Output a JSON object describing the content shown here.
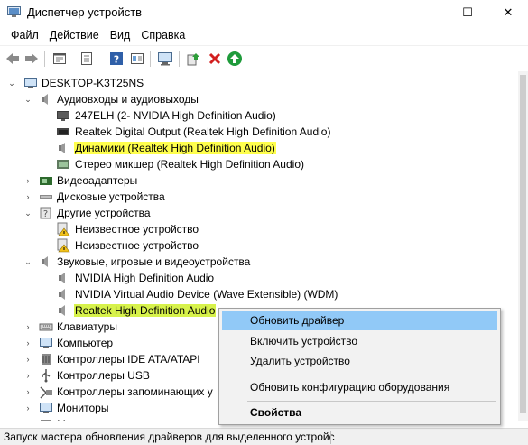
{
  "window": {
    "title": "Диспетчер устройств",
    "minimize_glyph": "—",
    "maximize_glyph": "☐",
    "close_glyph": "✕"
  },
  "menubar": [
    "Файл",
    "Действие",
    "Вид",
    "Справка"
  ],
  "toolbar": {
    "buttons": [
      "back-arrow-icon",
      "forward-arrow-icon",
      "properties-icon",
      "update-list-icon",
      "help-icon",
      "details-icon",
      "monitor-icon",
      "update-driver-icon",
      "remove-device-icon",
      "enable-device-icon"
    ]
  },
  "tree": {
    "root": "DESKTOP-K3T25NS",
    "audio_io": {
      "label": "Аудиовходы и аудиовыходы",
      "children": [
        "247ELH (2- NVIDIA High Definition Audio)",
        "Realtek Digital Output (Realtek High Definition Audio)",
        "Динамики (Realtek High Definition Audio)",
        "Стерео микшер (Realtek High Definition Audio)"
      ]
    },
    "video_adapters": "Видеоадаптеры",
    "disk_devices": "Дисковые устройства",
    "other_devices": {
      "label": "Другие устройства",
      "children": [
        "Неизвестное устройство",
        "Неизвестное устройство"
      ]
    },
    "sound_devices": {
      "label": "Звуковые, игровые и видеоустройства",
      "children": [
        "NVIDIA High Definition Audio",
        "NVIDIA Virtual Audio Device (Wave Extensible) (WDM)",
        "Realtek High Definition Audio"
      ]
    },
    "collapsed_groups": [
      "Клавиатуры",
      "Компьютер",
      "Контроллеры IDE ATA/ATAPI",
      "Контроллеры USB",
      "Контроллеры запоминающих у",
      "Мониторы",
      "Мо"
    ]
  },
  "context_menu": {
    "items": [
      "Обновить драйвер",
      "Включить устройство",
      "Удалить устройство",
      "Обновить конфигурацию оборудования",
      "Свойства"
    ]
  },
  "statusbar": {
    "text": "Запуск мастера обновления драйверов для выделенного устройс"
  },
  "colors": {
    "highlight_yellow": "#ffff4d",
    "highlight_green": "#d7f24b",
    "menu_active": "#91c9f7"
  }
}
